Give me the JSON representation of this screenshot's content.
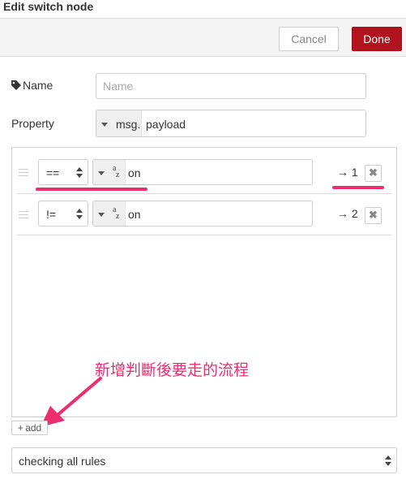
{
  "dialog": {
    "title": "Edit switch node",
    "cancel_label": "Cancel",
    "done_label": "Done"
  },
  "form": {
    "name": {
      "label": "Name",
      "placeholder": "Name",
      "value": ""
    },
    "property": {
      "label": "Property",
      "prefix": "msg.",
      "value": "payload"
    }
  },
  "rules": [
    {
      "operator": "==",
      "type_glyph_top": "a",
      "type_glyph_bottom": "z",
      "value": "on",
      "output": "→ 1"
    },
    {
      "operator": "!=",
      "type_glyph_top": "a",
      "type_glyph_bottom": "z",
      "value": "on",
      "output": "→ 2"
    }
  ],
  "annotation": {
    "text": "新增判斷後要走的流程",
    "color": "#ec2e6e"
  },
  "add_label": "add",
  "mode": {
    "selected": "checking all rules"
  },
  "colors": {
    "done_button": "#b1141c",
    "highlight": "#ec2e6e"
  },
  "icons": [
    "tag-icon",
    "caret-down-icon",
    "updown-arrows-icon",
    "drag-handle-icon",
    "close-icon",
    "plus-icon",
    "arrow-annotation-icon"
  ]
}
